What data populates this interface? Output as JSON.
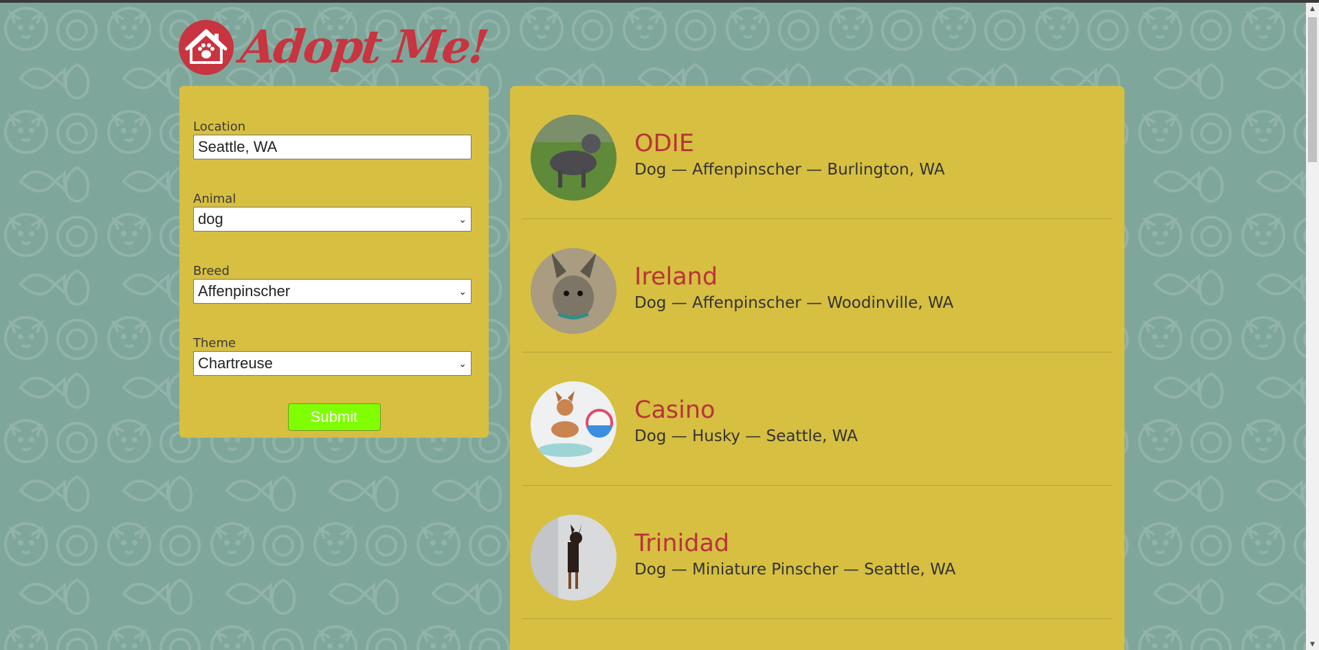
{
  "app": {
    "logo_text": "Adopt Me!"
  },
  "search": {
    "location_label": "Location",
    "location_value": "Seattle, WA",
    "animal_label": "Animal",
    "animal_value": "dog",
    "breed_label": "Breed",
    "breed_value": "Affenpinscher",
    "theme_label": "Theme",
    "theme_value": "Chartreuse",
    "submit_label": "Submit"
  },
  "results": [
    {
      "name": "ODIE",
      "description": "Dog — Affenpinscher — Burlington, WA"
    },
    {
      "name": "Ireland",
      "description": "Dog — Affenpinscher — Woodinville, WA"
    },
    {
      "name": "Casino",
      "description": "Dog — Husky — Seattle, WA"
    },
    {
      "name": "Trinidad",
      "description": "Dog — Miniature Pinscher — Seattle, WA"
    }
  ],
  "colors": {
    "background": "#7fa69b",
    "panel": "#d7bf41",
    "brand": "#c8343f",
    "pet_name": "#b8333b",
    "submit": "#7fff00"
  }
}
